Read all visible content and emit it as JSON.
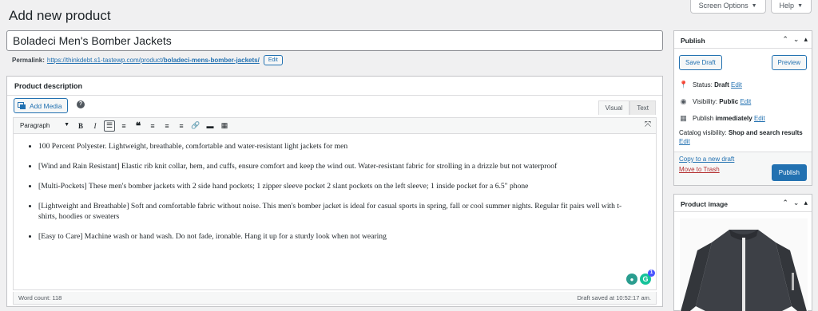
{
  "screen_meta": {
    "screen_options": "Screen Options",
    "help": "Help"
  },
  "page_title": "Add new product",
  "product_title": "Boladeci Men's Bomber Jackets",
  "permalink": {
    "label": "Permalink:",
    "base": "https://thinkdebt.s1-tastewp.com/product/",
    "slug": "boladeci-mens-bomber-jackets/",
    "edit": "Edit"
  },
  "description": {
    "heading": "Product description",
    "add_media": "Add Media",
    "help": "?",
    "tabs": {
      "visual": "Visual",
      "text": "Text"
    },
    "format": "Paragraph",
    "bullets": [
      "100 Percent Polyester. Lightweight, breathable, comfortable and water-resistant light jackets for men",
      "[Wind and Rain Resistant] Elastic rib knit collar, hem, and cuffs, ensure comfort and keep the wind out. Water-resistant fabric for strolling in a drizzle but not waterproof",
      "[Multi-Pockets] These men's bomber jackets with 2 side hand pockets; 1 zipper sleeve pocket 2 slant pockets on the left sleeve; 1 inside pocket for a 6.5\" phone",
      "[Lightweight and Breathable] Soft and comfortable fabric without noise. This men's bomber jacket is ideal for casual sports in spring, fall or cool summer nights. Regular fit pairs well with t-shirts, hoodies or sweaters",
      "[Easy to Care] Machine wash or hand wash. Do not fade, ironable. Hang it up for a sturdy look when not wearing"
    ],
    "grammarly_badge": "1",
    "word_count": "Word count: 118",
    "draft_saved": "Draft saved at 10:52:17 am."
  },
  "publish": {
    "heading": "Publish",
    "save_draft": "Save Draft",
    "preview": "Preview",
    "status_label": "Status:",
    "status_value": "Draft",
    "visibility_label": "Visibility:",
    "visibility_value": "Public",
    "publish_label": "Publish",
    "publish_value": "immediately",
    "edit": "Edit",
    "catalog_label": "Catalog visibility:",
    "catalog_value": "Shop and search results",
    "copy_draft": "Copy to a new draft",
    "trash": "Move to Trash",
    "publish_button": "Publish"
  },
  "product_image": {
    "heading": "Product image"
  },
  "colors": {
    "accent": "#2271b1",
    "trash": "#b32d2e",
    "background": "#f0f0f1"
  }
}
